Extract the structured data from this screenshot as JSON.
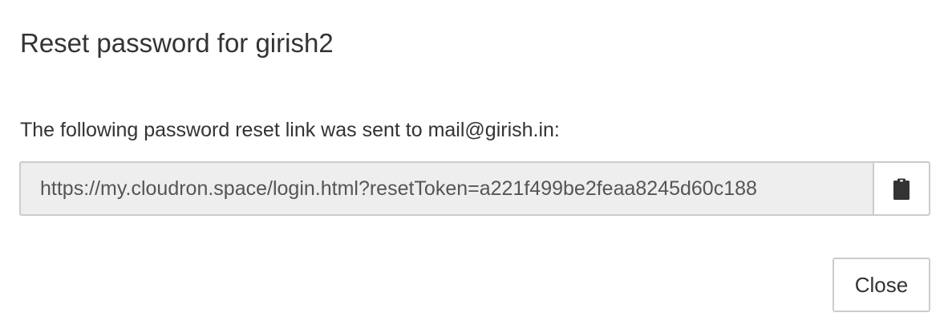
{
  "dialog": {
    "title": "Reset password for girish2",
    "message": "The following password reset link was sent to mail@girish.in:",
    "reset_link": {
      "value": "https://my.cloudron.space/login.html?resetToken=a221f499be2feaa8245d60c188"
    },
    "copy_button": {
      "icon": "clipboard-icon"
    },
    "close_label": "Close"
  }
}
